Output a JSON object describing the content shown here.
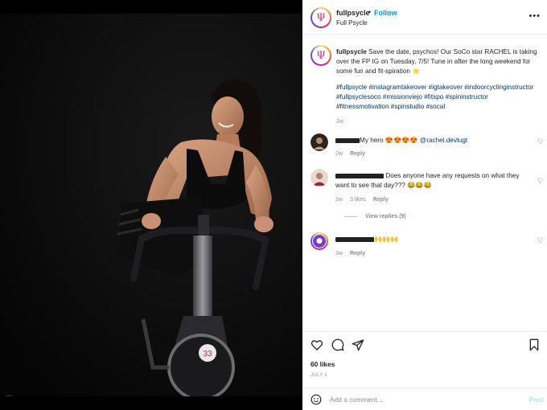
{
  "post": {
    "username": "fullpsycle",
    "dot": "•",
    "follow_label": "Follow",
    "subtitle": "Full Psycle",
    "logo_glyph": "Ψ",
    "more_icon": "more-horizontal-icon",
    "caption_username": "fullpsycle",
    "caption_text": " Save the date, psychos! Our SoCo star RACHEL is taking over the FP IG on Tuesday, 7/5! Tune in after the long weekend for some fun and fit-spiration ⭐",
    "hashtags": "#fullpsycle #instagramtakeover #igtakeover #indoorcyclinginstructor #fullpsyclesoco #missionviejo #fitspo #spininstructor #fitnessmotivation #spinstudio #socal",
    "caption_time": "2w"
  },
  "comments": [
    {
      "text": "My hero 😍😍😍😍 ",
      "mention": "@rachel.devlugt",
      "time": "2w",
      "likes": "",
      "reply_label": "Reply"
    },
    {
      "text": " Does anyone have any requests on what they want to see that day??? 😂😂😂",
      "time": "2w",
      "likes": "3 likes",
      "reply_label": "Reply",
      "view_replies": "View replies (9)"
    },
    {
      "text": "🙌🙌🙌",
      "time": "2w",
      "likes": "",
      "reply_label": "Reply"
    }
  ],
  "actions": {
    "likes": "60 likes",
    "date": "JULY 1"
  },
  "add_comment": {
    "placeholder": "Add a comment...",
    "post_label": "Post"
  },
  "bike": {
    "badge": "33"
  },
  "colors": {
    "link": "#00376b",
    "follow": "#0095f6",
    "post_disabled": "#b2dffc"
  }
}
